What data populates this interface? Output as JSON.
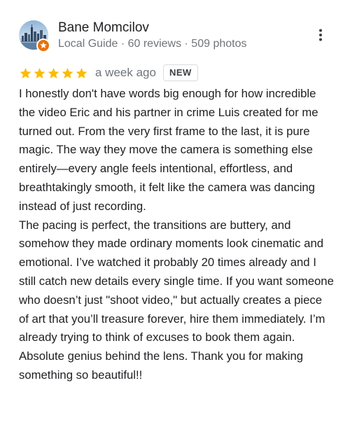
{
  "review": {
    "author": {
      "name": "Bane Momcilov",
      "meta": "Local Guide · 60 reviews · 509 photos",
      "avatar_icon": "city-skyline-photo",
      "badge_icon": "local-guide-star-icon",
      "badge_color": "#e8710a"
    },
    "menu_icon": "more-vert-icon",
    "rating": {
      "stars": 5,
      "max": 5,
      "star_color": "#fbbc04",
      "time": "a week ago",
      "badge": "NEW"
    },
    "paragraphs": [
      "I honestly don't have words big enough for how incredible the video Eric and his partner in crime Luis created for me turned out. From the very first frame to the last, it is pure magic. The way they move the camera is something else entirely—every angle feels intentional, effortless, and breathtakingly smooth, it felt like the camera was dancing instead of just recording.",
      "The pacing is perfect, the transitions are buttery, and somehow they made ordinary moments look cinematic and emotional. I’ve watched it probably 20 times already and I still catch new details every single time. If you want someone who doesn’t just \"shoot video,\" but actually creates a piece of art that you’ll treasure forever, hire them immediately. I’m already trying to think of excuses to book them again. Absolute genius behind the lens. Thank you for making something so beautiful!!"
    ]
  }
}
